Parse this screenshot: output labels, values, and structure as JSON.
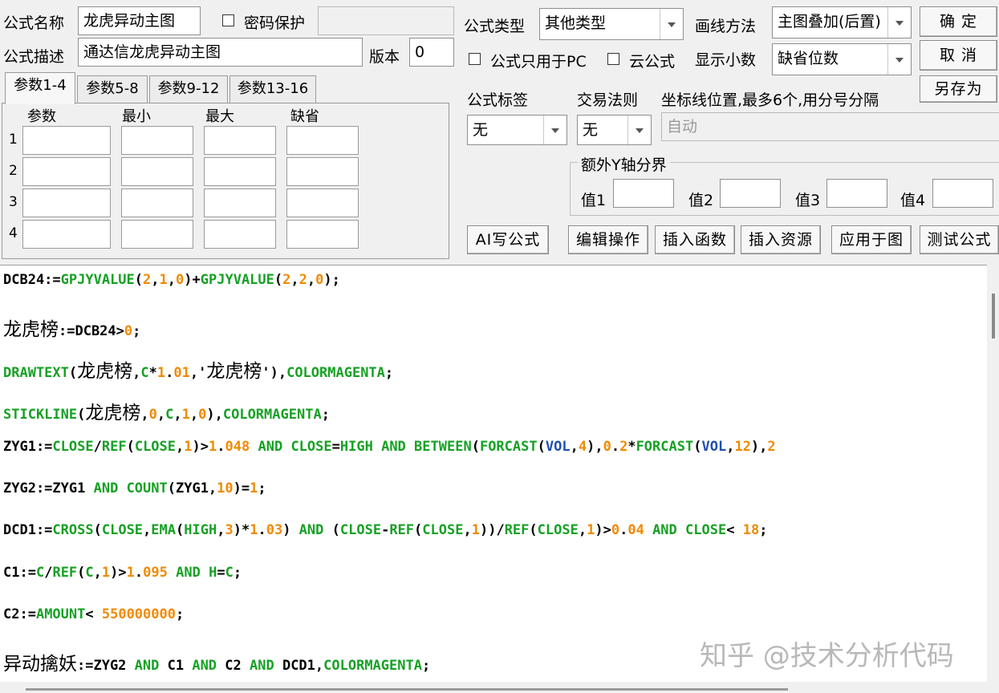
{
  "form": {
    "name_label": "公式名称",
    "name_value": "龙虎异动主图",
    "password_label": "密码保护",
    "desc_label": "公式描述",
    "desc_value": "通达信龙虎异动主图",
    "version_label": "版本",
    "version_value": "0",
    "type_label": "公式类型",
    "type_value": "其他类型",
    "draw_label": "画线方法",
    "draw_value": "主图叠加(后置)",
    "pc_only_label": "公式只用于PC",
    "cloud_label": "云公式",
    "decimals_label": "显示小数",
    "decimals_value": "缺省位数",
    "tag_label": "公式标签",
    "tag_value": "无",
    "trade_label": "交易法则",
    "trade_value": "无",
    "coordinate_label": "坐标线位置,最多6个,用分号分隔",
    "coordinate_placeholder": "自动",
    "extra_y_label": "额外Y轴分界",
    "y_values": [
      "值1",
      "值2",
      "值3",
      "值4"
    ]
  },
  "buttons": {
    "ok": "确  定",
    "cancel": "取  消",
    "save_as": "另存为",
    "ai": "AI写公式",
    "edit_ops": "编辑操作",
    "insert_func": "插入函数",
    "insert_res": "插入资源",
    "apply": "应用于图",
    "test": "测试公式"
  },
  "params": {
    "tabs": [
      "参数1-4",
      "参数5-8",
      "参数9-12",
      "参数13-16"
    ],
    "headers": [
      "参数",
      "最小",
      "最大",
      "缺省"
    ],
    "rows": [
      "1",
      "2",
      "3",
      "4"
    ]
  },
  "code": [
    [
      [
        "i",
        "DCB24:="
      ],
      [
        "f",
        "GPJYVALUE"
      ],
      [
        "i",
        "("
      ],
      [
        "n",
        "2"
      ],
      [
        "i",
        ","
      ],
      [
        "n",
        "1"
      ],
      [
        "i",
        ","
      ],
      [
        "n",
        "0"
      ],
      [
        "i",
        ")+"
      ],
      [
        "f",
        "GPJYVALUE"
      ],
      [
        "i",
        "("
      ],
      [
        "n",
        "2"
      ],
      [
        "i",
        ","
      ],
      [
        "n",
        "2"
      ],
      [
        "i",
        ","
      ],
      [
        "n",
        "0"
      ],
      [
        "i",
        ");"
      ]
    ],
    [
      [
        "z",
        "龙虎榜"
      ],
      [
        "i",
        ":=DCB24>"
      ],
      [
        "n",
        "0"
      ],
      [
        "i",
        ";"
      ]
    ],
    [
      [
        "f",
        "DRAWTEXT"
      ],
      [
        "i",
        "("
      ],
      [
        "z",
        "龙虎榜"
      ],
      [
        "i",
        ","
      ],
      [
        "f",
        "C"
      ],
      [
        "i",
        "*"
      ],
      [
        "n",
        "1"
      ],
      [
        "i",
        "."
      ],
      [
        "n",
        "01"
      ],
      [
        "i",
        ",'"
      ],
      [
        "z",
        "龙虎榜"
      ],
      [
        "i",
        "'),"
      ],
      [
        "f",
        "COLORMAGENTA"
      ],
      [
        "i",
        ";"
      ]
    ],
    [
      [
        "f",
        "STICKLINE"
      ],
      [
        "i",
        "("
      ],
      [
        "z",
        "龙虎榜"
      ],
      [
        "i",
        ","
      ],
      [
        "n",
        "0"
      ],
      [
        "i",
        ","
      ],
      [
        "f",
        "C"
      ],
      [
        "i",
        ","
      ],
      [
        "n",
        "1"
      ],
      [
        "i",
        ","
      ],
      [
        "n",
        "0"
      ],
      [
        "i",
        "),"
      ],
      [
        "f",
        "COLORMAGENTA"
      ],
      [
        "i",
        ";"
      ]
    ],
    [
      [
        "i",
        "ZYG1:="
      ],
      [
        "f",
        "CLOSE"
      ],
      [
        "i",
        "/"
      ],
      [
        "f",
        "REF"
      ],
      [
        "i",
        "("
      ],
      [
        "f",
        "CLOSE"
      ],
      [
        "i",
        ","
      ],
      [
        "n",
        "1"
      ],
      [
        "i",
        ")>"
      ],
      [
        "n",
        "1"
      ],
      [
        "i",
        "."
      ],
      [
        "n",
        "048"
      ],
      [
        "i",
        " "
      ],
      [
        "f",
        "AND"
      ],
      [
        "i",
        " "
      ],
      [
        "f",
        "CLOSE"
      ],
      [
        "i",
        "="
      ],
      [
        "f",
        "HIGH"
      ],
      [
        "i",
        " "
      ],
      [
        "f",
        "AND"
      ],
      [
        "i",
        " "
      ],
      [
        "f",
        "BETWEEN"
      ],
      [
        "i",
        "("
      ],
      [
        "f",
        "FORCAST"
      ],
      [
        "i",
        "("
      ],
      [
        "b",
        "VOL"
      ],
      [
        "i",
        ","
      ],
      [
        "n",
        "4"
      ],
      [
        "i",
        "),"
      ],
      [
        "n",
        "0"
      ],
      [
        "i",
        "."
      ],
      [
        "n",
        "2"
      ],
      [
        "i",
        "*"
      ],
      [
        "f",
        "FORCAST"
      ],
      [
        "i",
        "("
      ],
      [
        "b",
        "VOL"
      ],
      [
        "i",
        ","
      ],
      [
        "n",
        "12"
      ],
      [
        "i",
        "),"
      ],
      [
        "n",
        "2"
      ]
    ],
    [
      [
        "i",
        "ZYG2:=ZYG1 "
      ],
      [
        "f",
        "AND"
      ],
      [
        "i",
        " "
      ],
      [
        "f",
        "COUNT"
      ],
      [
        "i",
        "(ZYG1,"
      ],
      [
        "n",
        "10"
      ],
      [
        "i",
        ")="
      ],
      [
        "n",
        "1"
      ],
      [
        "i",
        ";"
      ]
    ],
    [
      [
        "i",
        "DCD1:="
      ],
      [
        "f",
        "CROSS"
      ],
      [
        "i",
        "("
      ],
      [
        "f",
        "CLOSE"
      ],
      [
        "i",
        ","
      ],
      [
        "f",
        "EMA"
      ],
      [
        "i",
        "("
      ],
      [
        "f",
        "HIGH"
      ],
      [
        "i",
        ","
      ],
      [
        "n",
        "3"
      ],
      [
        "i",
        ")*"
      ],
      [
        "n",
        "1"
      ],
      [
        "i",
        "."
      ],
      [
        "n",
        "03"
      ],
      [
        "i",
        ") "
      ],
      [
        "f",
        "AND"
      ],
      [
        "i",
        " ("
      ],
      [
        "f",
        "CLOSE"
      ],
      [
        "i",
        "-"
      ],
      [
        "f",
        "REF"
      ],
      [
        "i",
        "("
      ],
      [
        "f",
        "CLOSE"
      ],
      [
        "i",
        ","
      ],
      [
        "n",
        "1"
      ],
      [
        "i",
        "))/"
      ],
      [
        "f",
        "REF"
      ],
      [
        "i",
        "("
      ],
      [
        "f",
        "CLOSE"
      ],
      [
        "i",
        ","
      ],
      [
        "n",
        "1"
      ],
      [
        "i",
        ")>"
      ],
      [
        "n",
        "0"
      ],
      [
        "i",
        "."
      ],
      [
        "n",
        "04"
      ],
      [
        "i",
        " "
      ],
      [
        "f",
        "AND"
      ],
      [
        "i",
        " "
      ],
      [
        "f",
        "CLOSE"
      ],
      [
        "i",
        "< "
      ],
      [
        "n",
        "18"
      ],
      [
        "i",
        ";"
      ]
    ],
    [
      [
        "i",
        "C1:="
      ],
      [
        "f",
        "C"
      ],
      [
        "i",
        "/"
      ],
      [
        "f",
        "REF"
      ],
      [
        "i",
        "("
      ],
      [
        "f",
        "C"
      ],
      [
        "i",
        ","
      ],
      [
        "n",
        "1"
      ],
      [
        "i",
        ")>"
      ],
      [
        "n",
        "1"
      ],
      [
        "i",
        "."
      ],
      [
        "n",
        "095"
      ],
      [
        "i",
        " "
      ],
      [
        "f",
        "AND"
      ],
      [
        "i",
        " "
      ],
      [
        "f",
        "H"
      ],
      [
        "i",
        "="
      ],
      [
        "f",
        "C"
      ],
      [
        "i",
        ";"
      ]
    ],
    [
      [
        "i",
        "C2:="
      ],
      [
        "f",
        "AMOUNT"
      ],
      [
        "i",
        "< "
      ],
      [
        "n",
        "550000000"
      ],
      [
        "i",
        ";"
      ]
    ],
    [
      [
        "z",
        "异动擒妖"
      ],
      [
        "i",
        ":=ZYG2 "
      ],
      [
        "f",
        "AND"
      ],
      [
        "i",
        " C1 "
      ],
      [
        "f",
        "AND"
      ],
      [
        "i",
        " C2 "
      ],
      [
        "f",
        "AND"
      ],
      [
        "i",
        " DCD1,"
      ],
      [
        "f",
        "COLORMAGENTA"
      ],
      [
        "i",
        ";"
      ]
    ]
  ],
  "watermark": "知乎 @技术分析代码"
}
